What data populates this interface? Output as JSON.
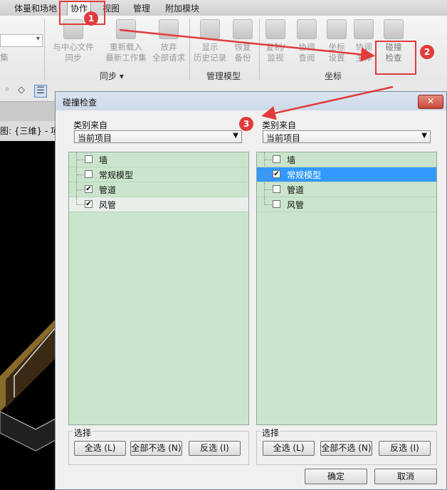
{
  "ribbon": {
    "tabs": [
      {
        "label": "体量和场地"
      },
      {
        "label": "协作",
        "active": true
      },
      {
        "label": "视图"
      },
      {
        "label": "管理"
      },
      {
        "label": "附加模块"
      }
    ],
    "left_partial_label": "集",
    "buttons": [
      {
        "label": "与中心文件\n同步",
        "icon": "sync-icon"
      },
      {
        "label": "重新载入\n最新工作集",
        "icon": "reload-icon"
      },
      {
        "label": "放弃\n全部请求",
        "icon": "relinquish-icon"
      },
      {
        "label": "显示\n历史记录",
        "icon": "history-icon"
      },
      {
        "label": "恢复\n备份",
        "icon": "restore-icon"
      },
      {
        "label": "复制/\n监视",
        "icon": "copy-monitor-icon"
      },
      {
        "label": "协调\n查阅",
        "icon": "review-icon"
      },
      {
        "label": "坐标\n设置",
        "icon": "settings-icon"
      },
      {
        "label": "协调\n主体",
        "icon": "host-icon"
      },
      {
        "label": "碰撞\n检查",
        "icon": "collision-icon"
      }
    ],
    "groups": [
      "同步 ▾",
      "管理模型",
      "坐标"
    ]
  },
  "view_tab_label": "图: {三维} - 项",
  "dialog": {
    "title": "碰撞检查",
    "close_glyph": "✕",
    "left": {
      "category_label": "类别来自",
      "category_value": "当前项目",
      "items": [
        {
          "label": "墙",
          "checked": false
        },
        {
          "label": "常规模型",
          "checked": false
        },
        {
          "label": "管道",
          "checked": true
        },
        {
          "label": "风管",
          "checked": true
        }
      ],
      "select_label": "选择",
      "buttons": [
        "全选 (L)",
        "全部不选 (N)",
        "反选 (I)"
      ]
    },
    "right": {
      "category_label": "类别来自",
      "category_value": "当前项目",
      "items": [
        {
          "label": "墙",
          "checked": false
        },
        {
          "label": "常规模型",
          "checked": true,
          "selected": true
        },
        {
          "label": "管道",
          "checked": false
        },
        {
          "label": "风管",
          "checked": false
        }
      ],
      "select_label": "选择",
      "buttons": [
        "全选 (L)",
        "全部不选 (N)",
        "反选 (I)"
      ]
    },
    "ok_label": "确定",
    "cancel_label": "取消"
  },
  "annotations": {
    "badges": [
      "1",
      "2",
      "3"
    ],
    "color": "#e23b3b"
  }
}
